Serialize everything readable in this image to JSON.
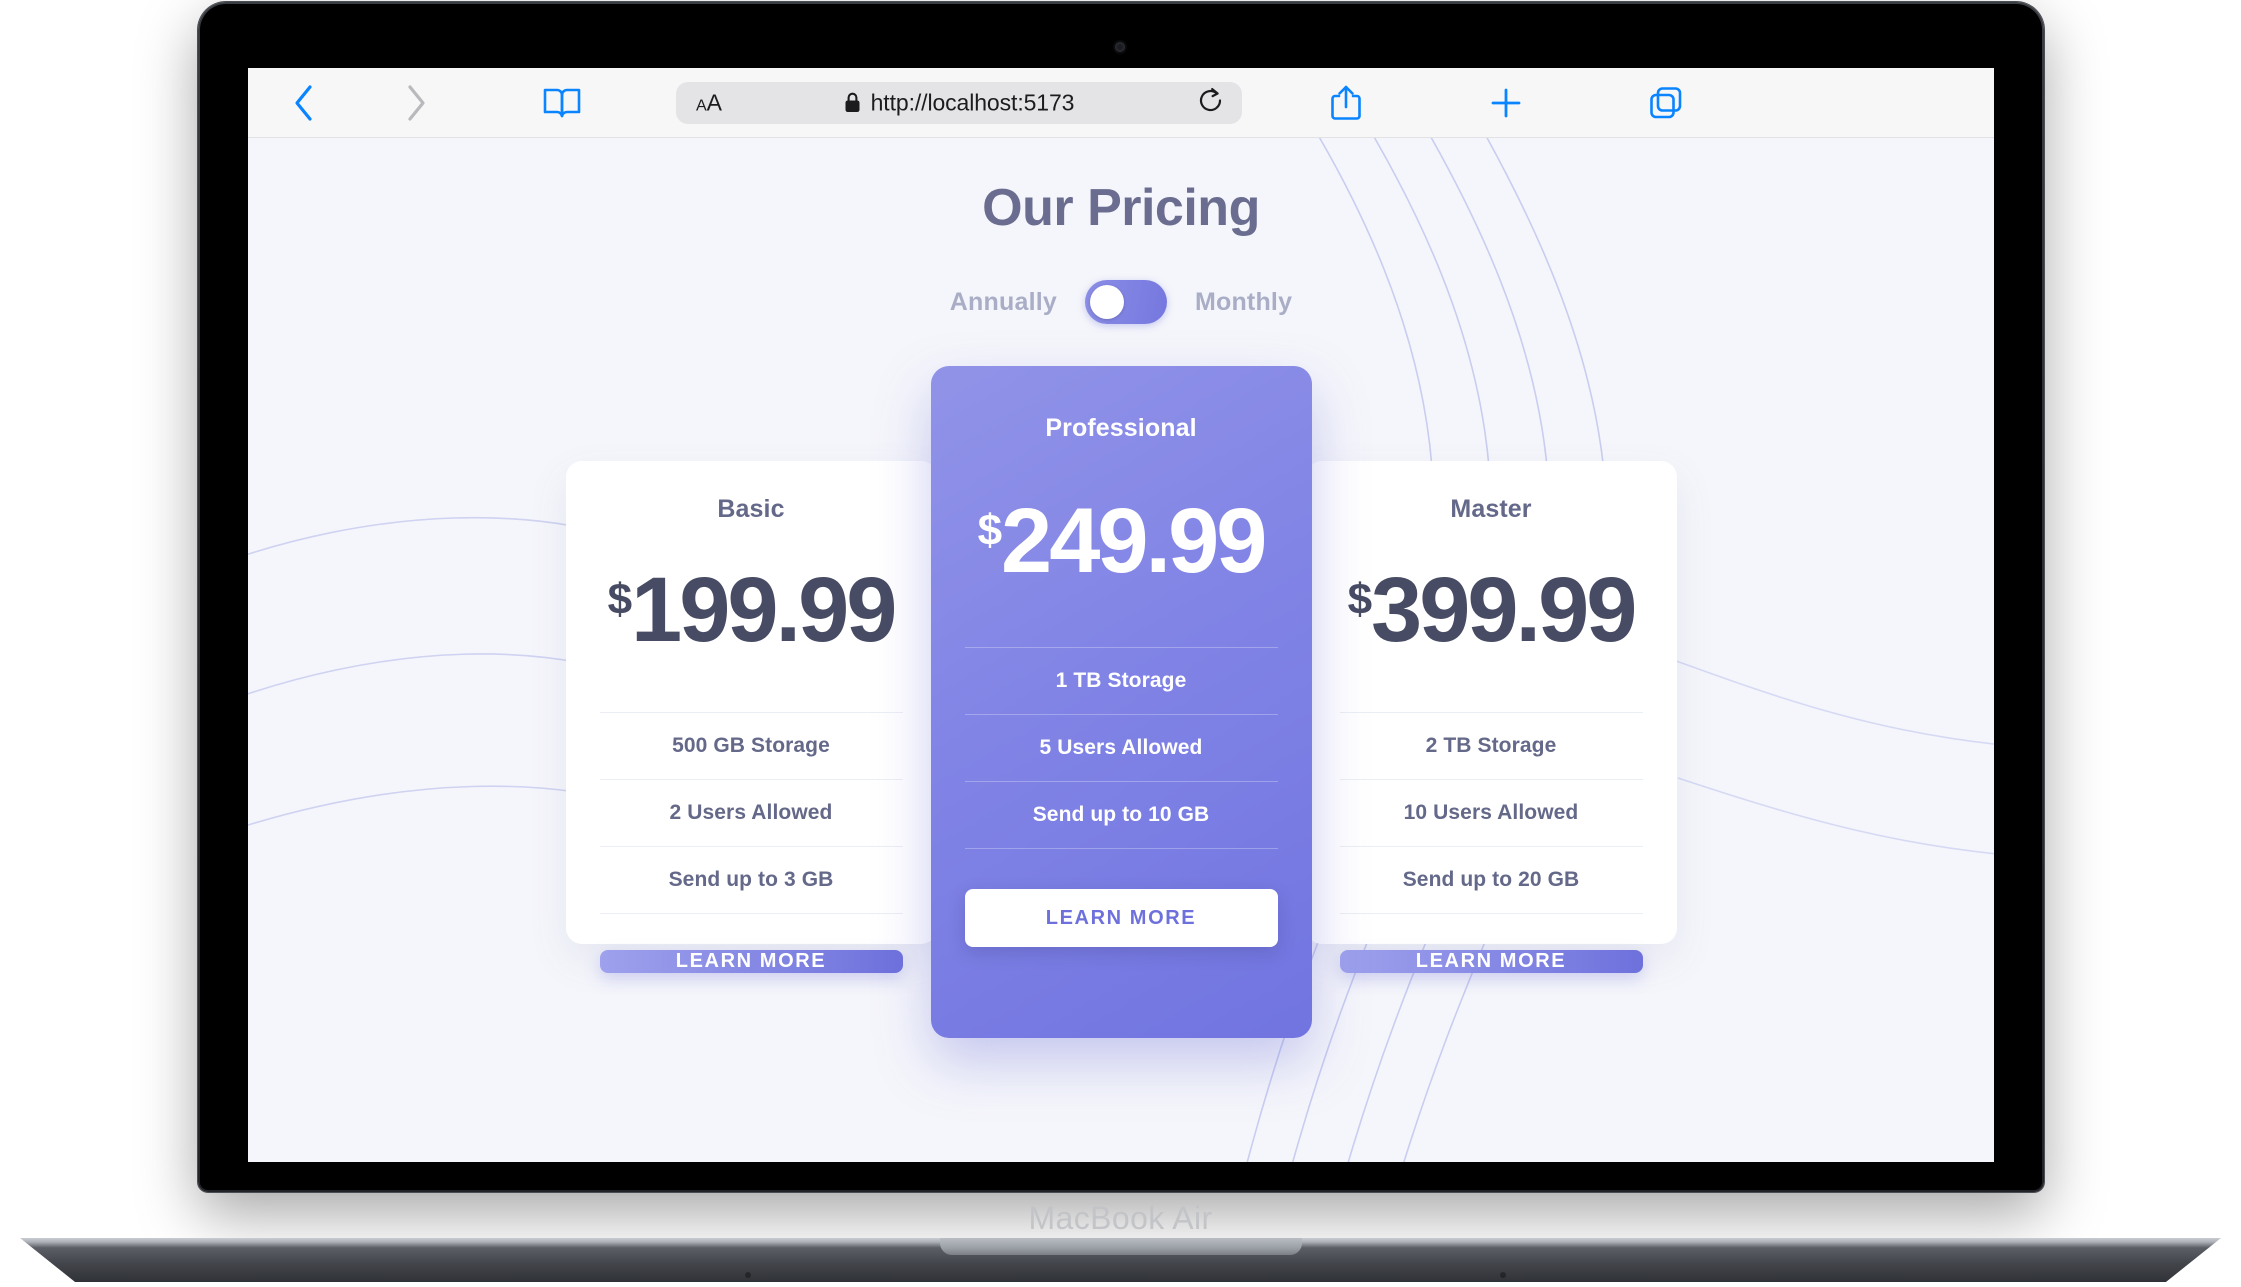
{
  "device": {
    "model_label": "MacBook Air"
  },
  "browser": {
    "back_icon": "chevron-left-icon",
    "forward_icon": "chevron-right-icon",
    "reader_icon": "book-icon",
    "text_size_small": "A",
    "text_size_large": "A",
    "lock_icon": "lock-icon",
    "url": "http://localhost:5173",
    "reload_icon": "reload-icon",
    "share_icon": "share-icon",
    "new_tab_icon": "plus-icon",
    "tabs_icon": "tabs-icon"
  },
  "page": {
    "title": "Our Pricing",
    "toggle": {
      "left_label": "Annually",
      "right_label": "Monthly",
      "active": "Annually",
      "knob_position": "left",
      "track_color": "#8184e5",
      "knob_color": "#ffffff"
    },
    "plans": [
      {
        "name": "Basic",
        "currency": "$",
        "amount": "199.99",
        "features": [
          "500 GB Storage",
          "2 Users Allowed",
          "Send up to 3 GB"
        ],
        "cta_label": "LEARN MORE",
        "featured": false,
        "card_bg": "#ffffff",
        "text_color": "#646889",
        "price_color": "#474b63",
        "cta_bg": "#7f82e2",
        "cta_text_color": "#ffffff"
      },
      {
        "name": "Professional",
        "currency": "$",
        "amount": "249.99",
        "features": [
          "1 TB Storage",
          "5 Users Allowed",
          "Send up to 10 GB"
        ],
        "cta_label": "LEARN MORE",
        "featured": true,
        "card_bg": "#8184e5",
        "text_color": "#ffffff",
        "price_color": "#ffffff",
        "cta_bg": "#ffffff",
        "cta_text_color": "#6e71dc"
      },
      {
        "name": "Master",
        "currency": "$",
        "amount": "399.99",
        "features": [
          "2 TB Storage",
          "10 Users Allowed",
          "Send up to 20 GB"
        ],
        "cta_label": "LEARN MORE",
        "featured": false,
        "card_bg": "#ffffff",
        "text_color": "#646889",
        "price_color": "#474b63",
        "cta_bg": "#7f82e2",
        "cta_text_color": "#ffffff"
      }
    ],
    "background_color": "#f5f6fb",
    "decoration_line_color": "#bfc3ee"
  }
}
